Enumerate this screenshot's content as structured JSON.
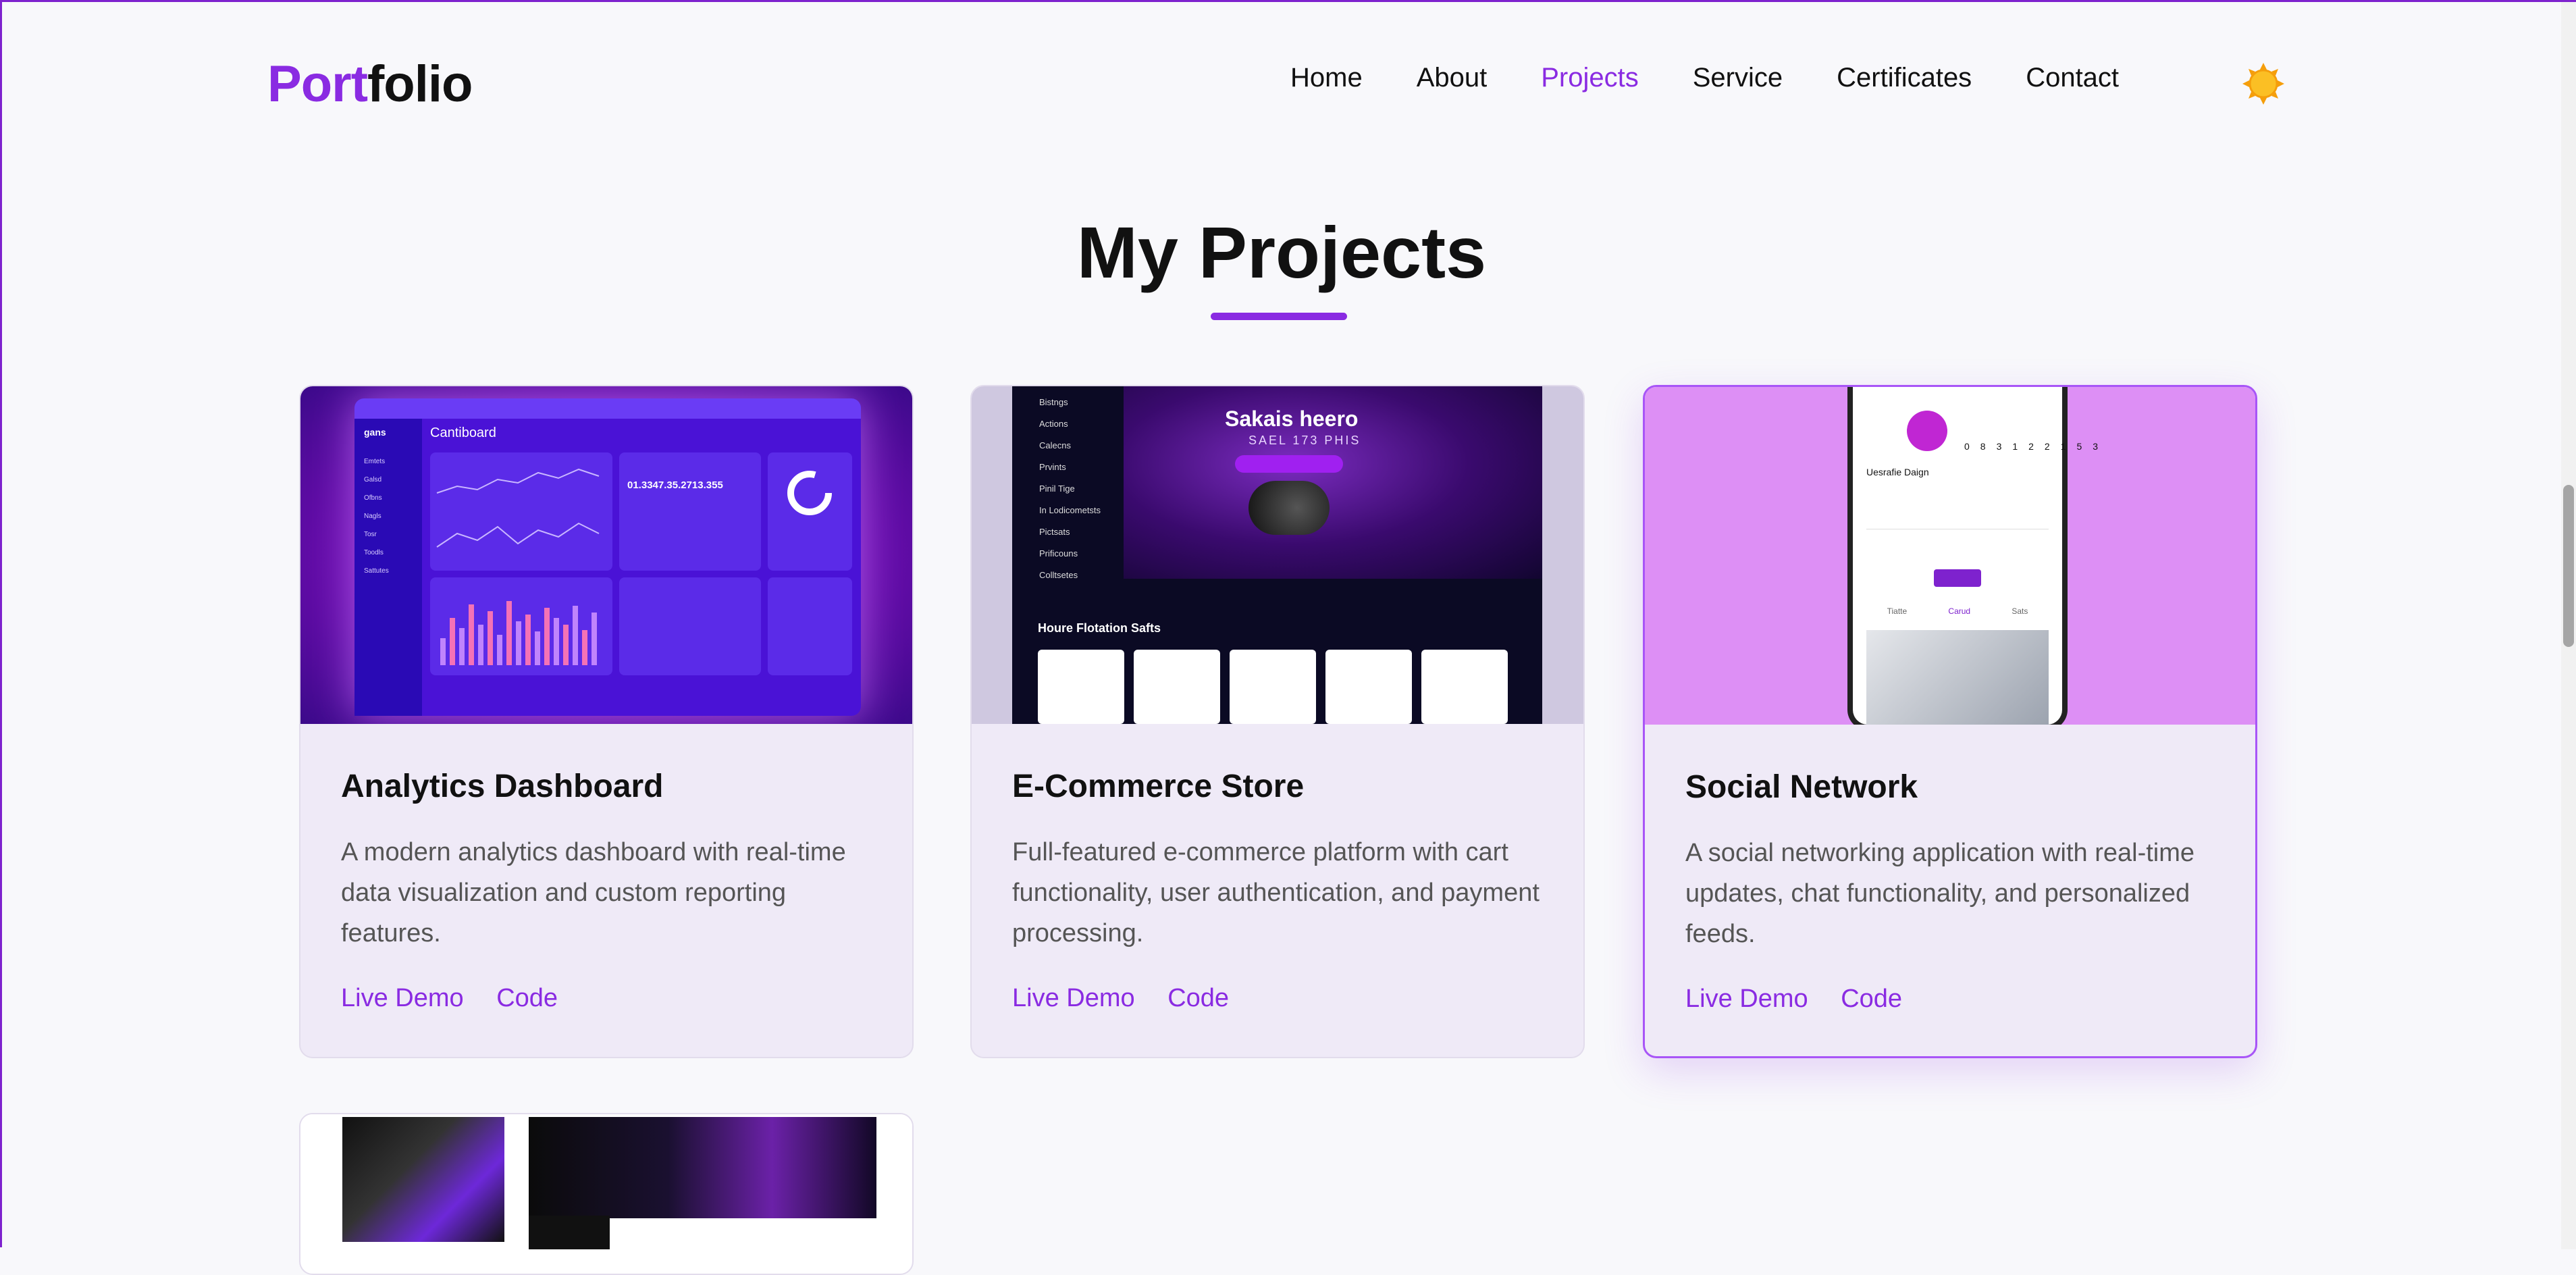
{
  "logo": {
    "part1": "Port",
    "part2": "folio"
  },
  "nav": [
    {
      "label": "Home",
      "active": false
    },
    {
      "label": "About",
      "active": false
    },
    {
      "label": "Projects",
      "active": true
    },
    {
      "label": "Service",
      "active": false
    },
    {
      "label": "Certificates",
      "active": false
    },
    {
      "label": "Contact",
      "active": false
    }
  ],
  "theme_toggle": {
    "icon": "sun-icon"
  },
  "section": {
    "title": "My Projects"
  },
  "colors": {
    "accent": "#8a2be2",
    "background": "#f8f8fb",
    "card": "#efeaf7"
  },
  "projects": [
    {
      "title": "Analytics Dashboard",
      "description": "A modern analytics dashboard with real-time data visualization and custom reporting features.",
      "demo_label": "Live Demo",
      "code_label": "Code",
      "thumb": {
        "brand": "gans",
        "heading": "Cantiboard",
        "menu": [
          "Emtets",
          "Galsd",
          "Ofbns",
          "Nagls",
          "Tosr",
          "Toodls",
          "Sattutes"
        ],
        "big_number": "01.3347.35.2713.355"
      }
    },
    {
      "title": "E-Commerce Store",
      "description": "Full-featured e-commerce platform with cart functionality, user authentication, and payment processing.",
      "demo_label": "Live Demo",
      "code_label": "Code",
      "thumb": {
        "hero_title": "Sakais heero",
        "hero_sub": "SAEL 173 PHIS",
        "menu": [
          "Bistngs",
          "Actions",
          "Calecns",
          "Prvints",
          "Pinil Tige",
          "In Lodicometsts",
          "Pictsats",
          "Prificouns",
          "Colltsetes"
        ],
        "section_title": "Houre Flotation Safts"
      }
    },
    {
      "title": "Social Network",
      "description": "A social networking application with real-time updates, chat functionality, and personalized feeds.",
      "demo_label": "Live Demo",
      "code_label": "Code",
      "thumb": {
        "profile_name": "Uesrafie Daign",
        "stats": [
          "083",
          "122",
          "153"
        ],
        "tabs": [
          "Tiatte",
          "Carud",
          "Sats"
        ]
      }
    }
  ]
}
